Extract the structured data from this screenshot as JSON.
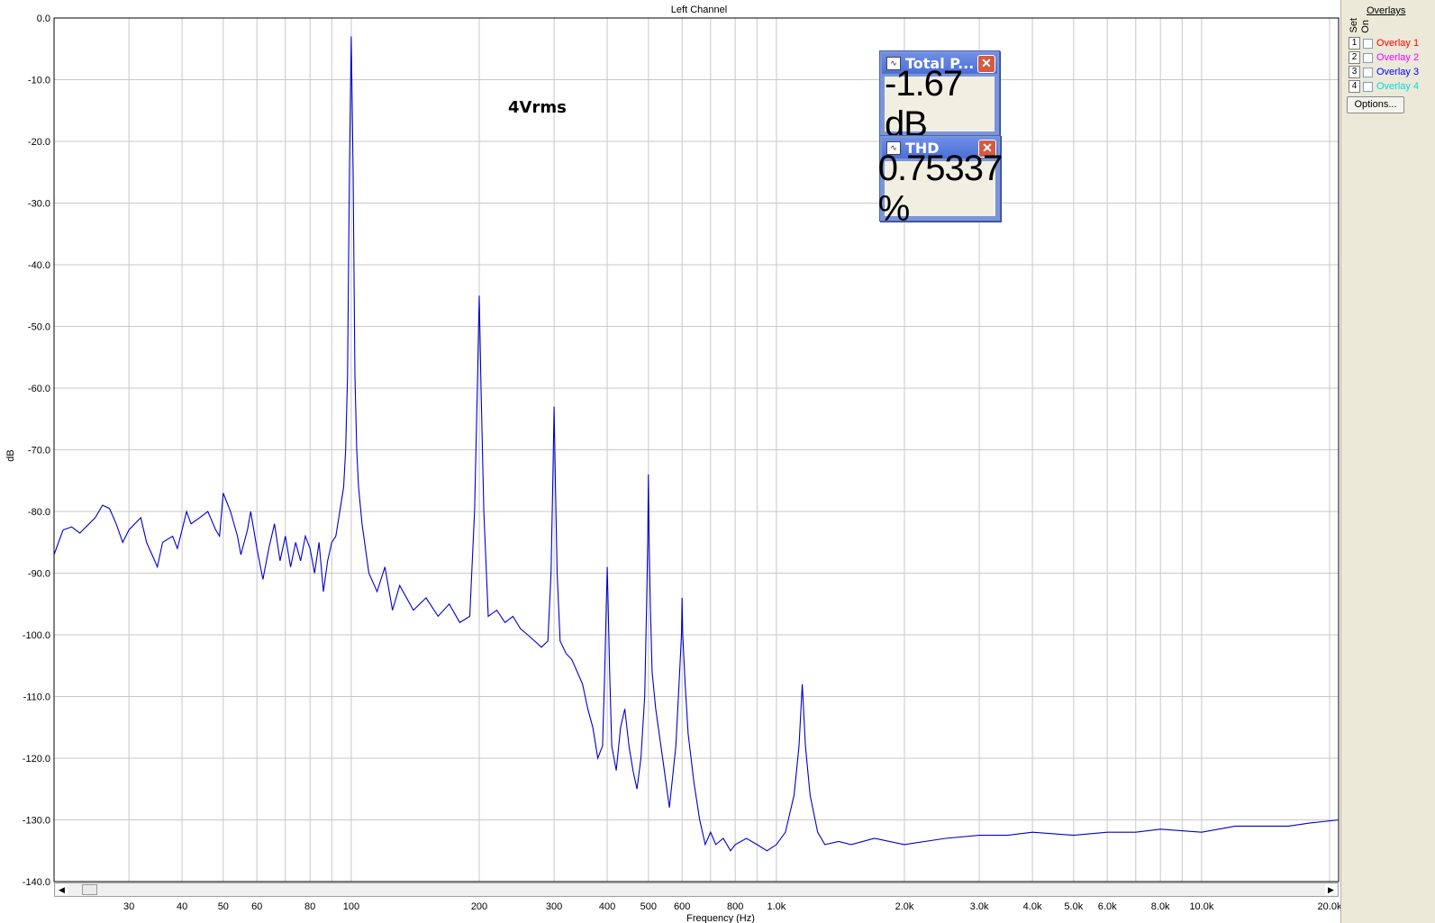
{
  "chart_data": {
    "type": "line",
    "title": "Left Channel",
    "xlabel": "Frequency (Hz)",
    "ylabel": "dB",
    "x_scale": "log",
    "xlim": [
      20,
      21000
    ],
    "ylim": [
      -140,
      0
    ],
    "x_ticks": [
      30,
      40,
      50,
      60,
      80,
      100,
      200,
      300,
      400,
      500,
      600,
      800,
      1000,
      2000,
      3000,
      4000,
      5000,
      6000,
      8000,
      10000,
      20000
    ],
    "x_tick_labels": [
      "30",
      "40",
      "50",
      "60",
      "80",
      "100",
      "200",
      "300",
      "400",
      "500",
      "600",
      "800",
      "1.0k",
      "2.0k",
      "3.0k",
      "4.0k",
      "5.0k",
      "6.0k",
      "8.0k",
      "10.0k",
      "20.0k"
    ],
    "y_ticks": [
      0,
      -10,
      -20,
      -30,
      -40,
      -50,
      -60,
      -70,
      -80,
      -90,
      -100,
      -110,
      -120,
      -130,
      -140
    ],
    "y_tick_labels": [
      "0.0",
      "-10.0",
      "-20.0",
      "-30.0",
      "-40.0",
      "-50.0",
      "-60.0",
      "-70.0",
      "-80.0",
      "-90.0",
      "-100.0",
      "-110.0",
      "-120.0",
      "-130.0",
      "-140.0"
    ],
    "grid": true,
    "line_color": "#0000cc",
    "annotation": "4Vrms",
    "series": [
      {
        "x": [
          20,
          21,
          22,
          23,
          25,
          26,
          27,
          28,
          29,
          30,
          32,
          33,
          34,
          35,
          36,
          38,
          39,
          40,
          41,
          42,
          44,
          46,
          48,
          49,
          50,
          52,
          54,
          55,
          57,
          58,
          60,
          62,
          64,
          66,
          68,
          70,
          72,
          74,
          76,
          78,
          80,
          82,
          84,
          86,
          88,
          90,
          92,
          94,
          96,
          97,
          98,
          99,
          100,
          101,
          102,
          103,
          104,
          106,
          108,
          110,
          115,
          120,
          125,
          130,
          140,
          150,
          160,
          170,
          180,
          190,
          195,
          198,
          200,
          202,
          205,
          210,
          220,
          230,
          240,
          250,
          260,
          270,
          280,
          290,
          295,
          298,
          300,
          302,
          305,
          310,
          320,
          330,
          340,
          350,
          360,
          370,
          380,
          390,
          395,
          398,
          400,
          402,
          405,
          410,
          420,
          430,
          440,
          450,
          460,
          470,
          480,
          490,
          495,
          498,
          500,
          502,
          505,
          510,
          520,
          540,
          560,
          580,
          590,
          598,
          600,
          602,
          610,
          620,
          640,
          660,
          680,
          700,
          720,
          750,
          780,
          800,
          850,
          900,
          950,
          1000,
          1050,
          1100,
          1130,
          1150,
          1170,
          1200,
          1250,
          1300,
          1400,
          1500,
          1700,
          2000,
          2500,
          3000,
          3500,
          4000,
          5000,
          6000,
          7000,
          8000,
          10000,
          12000,
          14000,
          16000,
          18000,
          21000
        ],
        "y": [
          -87,
          -83,
          -82.5,
          -83.5,
          -81,
          -79,
          -79.5,
          -82,
          -85,
          -83,
          -81,
          -85,
          -87,
          -89,
          -85,
          -84,
          -86,
          -83,
          -80,
          -82,
          -81,
          -80,
          -83,
          -84,
          -77,
          -80,
          -84,
          -87,
          -83,
          -80,
          -86,
          -91,
          -86,
          -82,
          -88,
          -84,
          -89,
          -85,
          -88,
          -84,
          -86,
          -90,
          -85,
          -93,
          -88,
          -85,
          -84,
          -80,
          -76,
          -70,
          -58,
          -25,
          -3,
          -25,
          -58,
          -70,
          -76,
          -82,
          -86,
          -90,
          -93,
          -89,
          -96,
          -92,
          -96,
          -94,
          -97,
          -95,
          -98,
          -97,
          -80,
          -60,
          -45,
          -60,
          -80,
          -97,
          -96,
          -98,
          -97,
          -99,
          -100,
          -101,
          -102,
          -101,
          -90,
          -75,
          -63,
          -75,
          -90,
          -101,
          -103,
          -104,
          -106,
          -108,
          -112,
          -115,
          -120,
          -118,
          -105,
          -95,
          -89,
          -95,
          -105,
          -118,
          -122,
          -115,
          -112,
          -118,
          -122,
          -125,
          -120,
          -110,
          -95,
          -85,
          -74,
          -85,
          -95,
          -106,
          -112,
          -120,
          -128,
          -118,
          -108,
          -100,
          -94,
          -100,
          -108,
          -116,
          -124,
          -130,
          -134,
          -132,
          -134,
          -133,
          -135,
          -134,
          -133,
          -134,
          -135,
          -134,
          -132,
          -126,
          -118,
          -108,
          -118,
          -126,
          -132,
          -134,
          -133.5,
          -134,
          -133,
          -134,
          -133,
          -132.5,
          -132.5,
          -132,
          -132.5,
          -132,
          -132,
          -131.5,
          -132,
          -131,
          -131,
          -131,
          -130.5,
          -130
        ]
      }
    ]
  },
  "meters": [
    {
      "title": "Total P...",
      "value": "-1.67 dB"
    },
    {
      "title": "THD",
      "value": "0.75337 %"
    }
  ],
  "overlay_panel": {
    "header": "Overlays",
    "col_set": "Set",
    "col_on": "On",
    "items": [
      {
        "num": "1",
        "label": "Overlay 1",
        "color": "#ff0000"
      },
      {
        "num": "2",
        "label": "Overlay 2",
        "color": "#ff00ff"
      },
      {
        "num": "3",
        "label": "Overlay 3",
        "color": "#0000ff"
      },
      {
        "num": "4",
        "label": "Overlay 4",
        "color": "#00ffff"
      }
    ],
    "options_label": "Options..."
  }
}
